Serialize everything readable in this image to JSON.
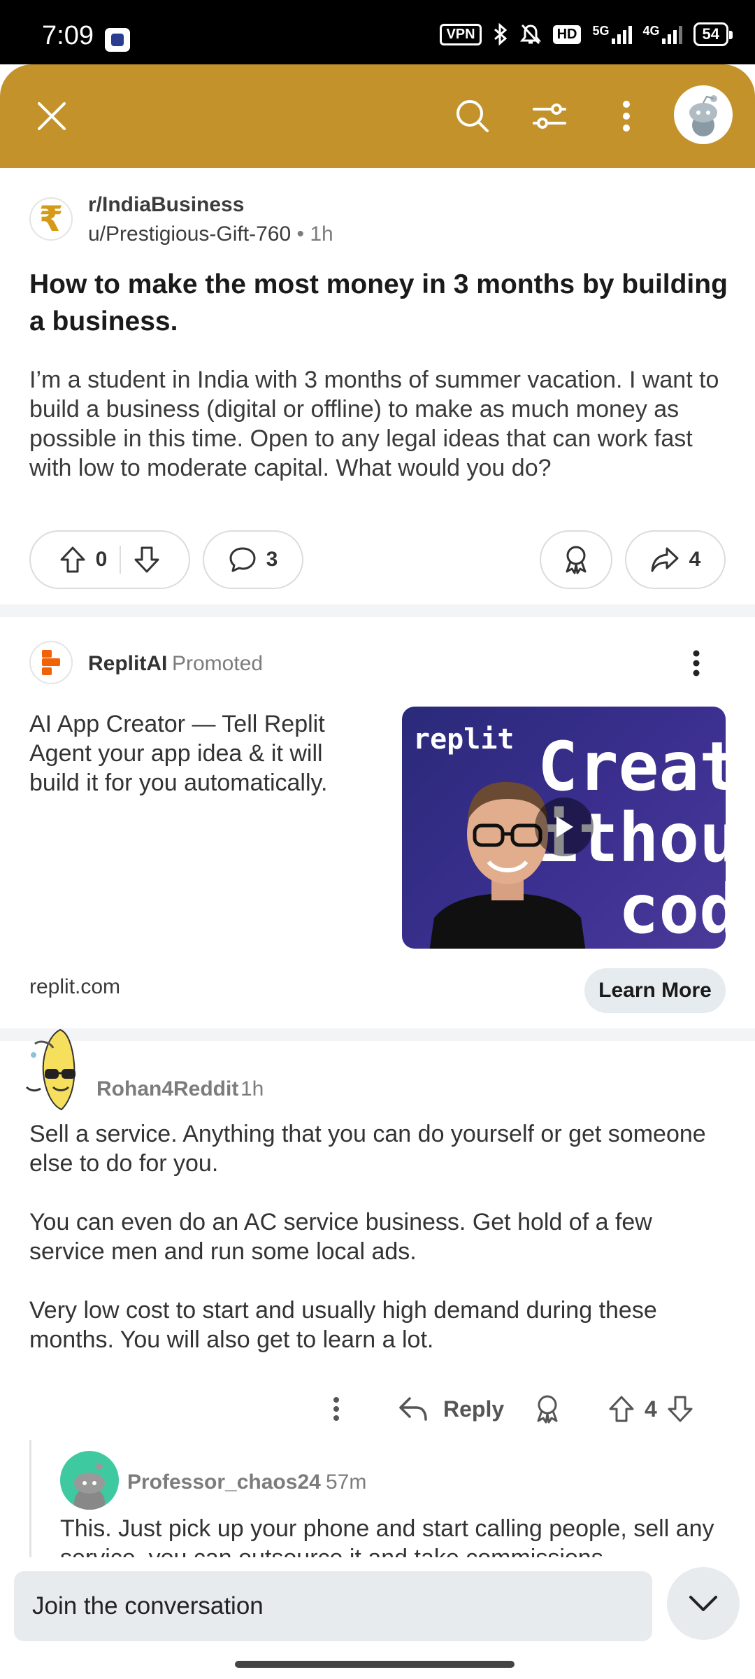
{
  "status_bar": {
    "time": "7:09",
    "vpn": "VPN",
    "hd": "HD",
    "net1": "5G",
    "net2": "4G",
    "battery": "54"
  },
  "header": {
    "icons": [
      "close-icon",
      "search-icon",
      "filter-icon",
      "more-vertical-icon",
      "avatar"
    ],
    "color": "#c4922b"
  },
  "post": {
    "subreddit": "r/IndiaBusiness",
    "subreddit_icon": "₹",
    "author": "u/Prestigious-Gift-760",
    "separator": "•",
    "time": "1h",
    "title": "How to make the most money in 3 months by building a business.",
    "body": "I’m a student in India with 3 months of summer vacation. I want to build a business (digital or offline) to make as much money as possible in this time. Open to any legal ideas that can work fast with low to moderate capital. What would you do?",
    "votes": "0",
    "comments": "3",
    "shares": "4"
  },
  "ad": {
    "advertiser": "ReplitAI",
    "promoted_label": "Promoted",
    "text": "AI App Creator — Tell Replit Agent your app idea & it will build it for you automatically.",
    "media_brand": "replit",
    "media_line1": "Creat",
    "media_line2": "withou",
    "media_line3": "cod",
    "domain": "replit.com",
    "cta": "Learn More"
  },
  "comment": {
    "user": "Rohan4Reddit",
    "time": "1h",
    "paragraphs": [
      "Sell a service. Anything that you can do yourself or get someone else to do for you.",
      "You can even do an AC service business. Get hold of a few service men and run some local ads.",
      "Very low cost to start and usually high demand during these months. You will also get to learn a lot."
    ],
    "reply_label": "Reply",
    "votes": "4"
  },
  "reply": {
    "user": "Professor_chaos24",
    "time": "57m",
    "body": "This. Just pick up your phone and start calling people, sell any service, you can outsource it and take commissions"
  },
  "bottom": {
    "placeholder": "Join the conversation"
  }
}
